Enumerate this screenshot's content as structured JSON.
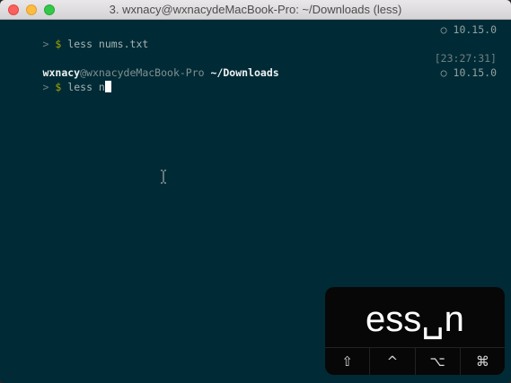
{
  "window": {
    "title": "3. wxnacy@wxnacydeMacBook-Pro: ~/Downloads (less)"
  },
  "terminal": {
    "line1": {
      "prompt_symbol": ">",
      "prompt_dollar": "$",
      "command": "less nums.txt",
      "right_icon": "○",
      "right_text": "10.15.0"
    },
    "line2": {
      "user": "wxnacy",
      "host": "@wxnacydeMacBook-Pro",
      "cwd": "~/Downloads",
      "timestamp": "[23:27:31]"
    },
    "line3": {
      "prompt_symbol": ">",
      "prompt_dollar": "$",
      "command": "less n",
      "right_icon": "○",
      "right_text": "10.15.0"
    }
  },
  "keycast": {
    "text": "ess␣n",
    "modifiers": [
      "⇧",
      "^",
      "⌥",
      "⌘"
    ]
  },
  "colors": {
    "terminal_bg": "#002b36",
    "keycast_bg": "#070707"
  }
}
